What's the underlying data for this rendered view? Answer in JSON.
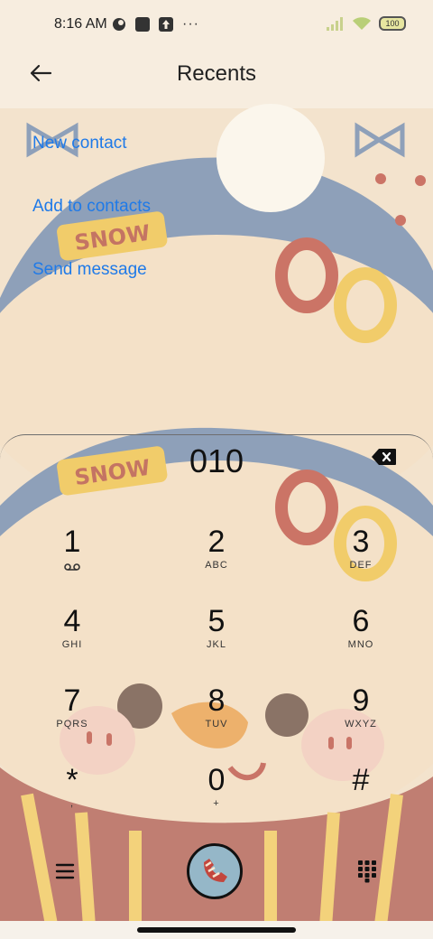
{
  "status_bar": {
    "time": "8:16 AM",
    "dots": "···",
    "battery": "100"
  },
  "header": {
    "title": "Recents"
  },
  "actions": {
    "new_contact": "New contact",
    "add_to_contacts": "Add to contacts",
    "send_message": "Send message"
  },
  "dialer": {
    "number": "010",
    "keys": [
      {
        "digit": "1",
        "letters": ""
      },
      {
        "digit": "2",
        "letters": "ABC"
      },
      {
        "digit": "3",
        "letters": "DEF"
      },
      {
        "digit": "4",
        "letters": "GHI"
      },
      {
        "digit": "5",
        "letters": "JKL"
      },
      {
        "digit": "6",
        "letters": "MNO"
      },
      {
        "digit": "7",
        "letters": "PQRS"
      },
      {
        "digit": "8",
        "letters": "TUV"
      },
      {
        "digit": "9",
        "letters": "WXYZ"
      },
      {
        "digit": "*",
        "letters": ","
      },
      {
        "digit": "0",
        "letters": "+"
      },
      {
        "digit": "#",
        "letters": ""
      }
    ]
  },
  "wallpaper_text": "SNOW",
  "colors": {
    "accent_blue": "#1f7ae8",
    "call_button": "#95b7c8"
  },
  "icons": {
    "back": "back-arrow-icon",
    "backspace": "backspace-icon",
    "voicemail": "voicemail-icon",
    "menu": "menu-icon",
    "call": "call-icon",
    "keypad": "keypad-icon"
  }
}
